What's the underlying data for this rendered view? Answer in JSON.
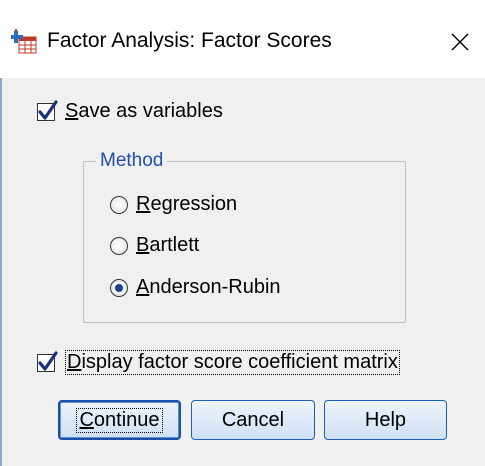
{
  "window": {
    "title": "Factor Analysis: Factor Scores",
    "close_glyph": "✕"
  },
  "save_as_variables": {
    "checked": true,
    "label_underlined": "S",
    "label_rest": "ave as variables"
  },
  "method": {
    "group_label": "Method",
    "options": [
      {
        "underlined": "R",
        "rest": "egression",
        "selected": false
      },
      {
        "underlined": "B",
        "rest": "artlett",
        "selected": false
      },
      {
        "underlined": "A",
        "rest": "nderson-Rubin",
        "selected": true
      }
    ]
  },
  "display_matrix": {
    "checked": true,
    "label_underlined": "D",
    "label_rest": "isplay factor score coefficient matrix"
  },
  "buttons": {
    "continue_underlined": "C",
    "continue_rest": "ontinue",
    "cancel": "Cancel",
    "help": "Help"
  },
  "colors": {
    "check_mark": "#1c2f7a",
    "group_label": "#2050a8",
    "button_border": "#1b5fbf"
  }
}
